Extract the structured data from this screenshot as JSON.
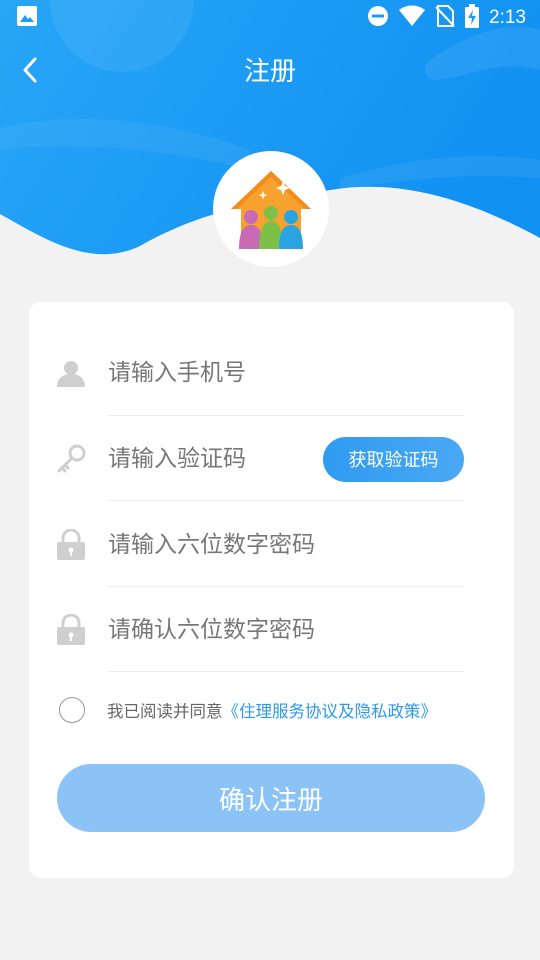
{
  "status_bar": {
    "time": "2:13",
    "icons": [
      "image-icon",
      "do-not-disturb-icon",
      "wifi-icon",
      "no-sim-icon",
      "battery-charging-icon"
    ]
  },
  "nav": {
    "title": "注册",
    "back_icon": "chevron-left-icon"
  },
  "form": {
    "phone_placeholder": "请输入手机号",
    "code_placeholder": "请输入验证码",
    "get_code_label": "获取验证码",
    "password_placeholder": "请输入六位数字密码",
    "confirm_password_placeholder": "请确认六位数字密码",
    "agreement_prefix": "我已阅读并同意",
    "agreement_link": "《住理服务协议及隐私政策》",
    "submit_label": "确认注册"
  },
  "colors": {
    "header_blue": "#1d9cf5",
    "accent": "#2f9bf0",
    "submit_disabled": "#8cc3f7",
    "link": "#2d9ae8"
  }
}
